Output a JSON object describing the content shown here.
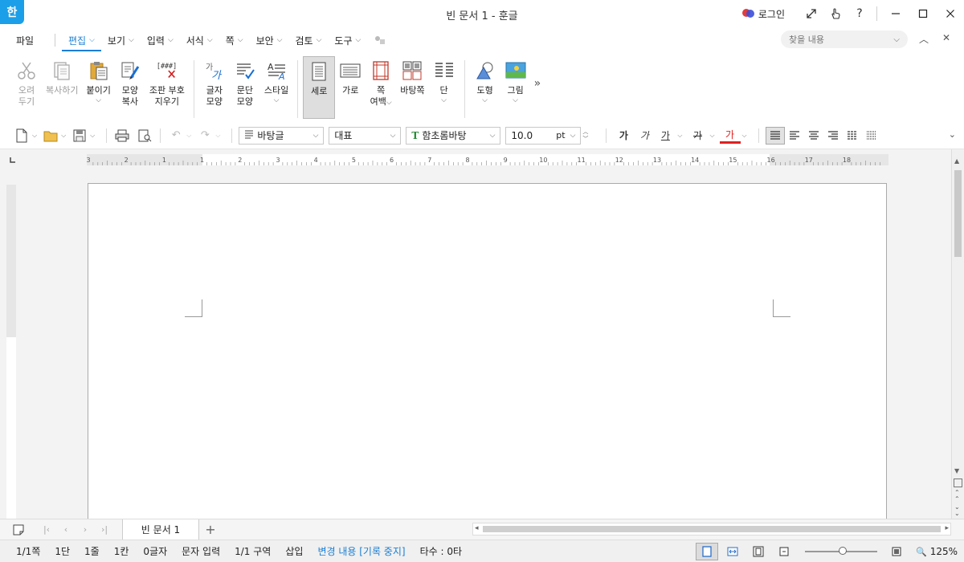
{
  "titlebar": {
    "app_logo": "한",
    "title": "빈 문서 1 - 훈글",
    "login_label": "로그인",
    "help_glyph": "?"
  },
  "menu": {
    "file": "파일",
    "tabs": [
      "편집",
      "보기",
      "입력",
      "서식",
      "쪽",
      "보안",
      "검토",
      "도구"
    ],
    "active_tab": "편집",
    "search_placeholder": "찾을 내용"
  },
  "ribbon": {
    "cut": [
      "오려",
      "두기"
    ],
    "copy": "복사하기",
    "paste": "붙이기",
    "format_copy": [
      "모양",
      "복사"
    ],
    "clear_markup": [
      "조판 부호",
      "지우기"
    ],
    "clear_markup_icon_text": "[###]",
    "char_shape": [
      "글자",
      "모양"
    ],
    "para_shape": [
      "문단",
      "모양"
    ],
    "style": "스타일",
    "portrait": "세로",
    "landscape": "가로",
    "page_margin": [
      "쪽",
      "여백"
    ],
    "background": "바탕쪽",
    "columns": "단",
    "shape": "도형",
    "picture": "그림"
  },
  "toolbar": {
    "style_value": "바탕글",
    "outline_value": "대표",
    "font_value": "함초롬바탕",
    "font_size": "10.0",
    "unit": "pt",
    "bold_glyph": "가",
    "italic_glyph": "가",
    "underline_glyph": "가",
    "strike_glyph": "가",
    "color_glyph": "가"
  },
  "ruler": {
    "h_ticks": [
      "3",
      "2",
      "1",
      "1",
      "2",
      "3",
      "4",
      "5",
      "6",
      "7",
      "8",
      "9",
      "10",
      "11",
      "12",
      "13",
      "14",
      "15",
      "16",
      "17",
      "18"
    ]
  },
  "tabs": {
    "doc_tab": "빈 문서 1"
  },
  "status": {
    "page": "1/1쪽",
    "col": "1단",
    "line": "1줄",
    "cell": "1칸",
    "chars": "0글자",
    "mode": "문자 입력",
    "section": "1/1 구역",
    "insert": "삽입",
    "track": "변경 내용 [기록 중지]",
    "typing": "타수 : 0타",
    "zoom": "125%"
  },
  "colors": {
    "accent": "#1a7fd4",
    "logo": "#1a9fe8",
    "font_color": "#e02020"
  }
}
